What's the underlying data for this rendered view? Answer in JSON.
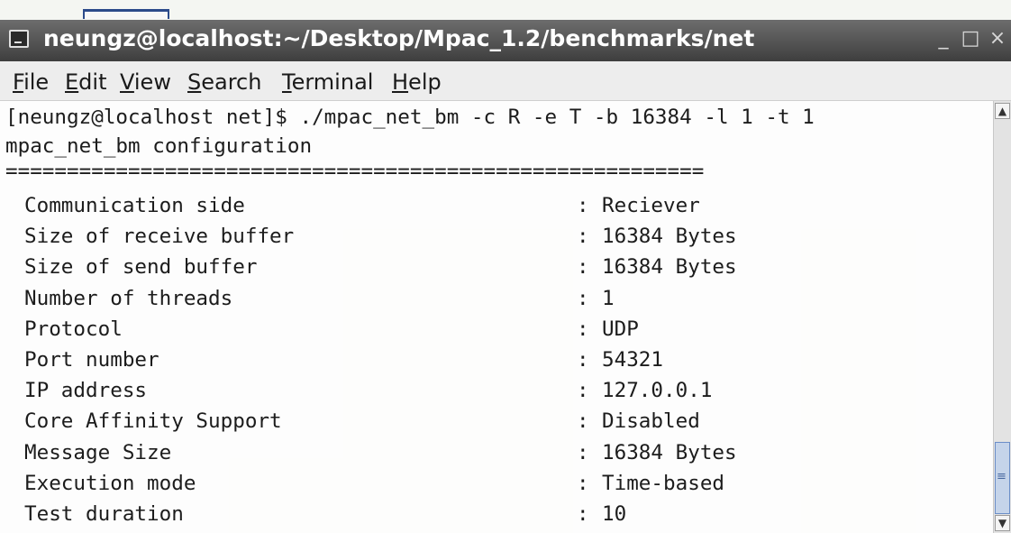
{
  "window": {
    "title": "neungz@localhost:~/Desktop/Mpac_1.2/benchmarks/net",
    "icon": "terminal-icon",
    "controls": {
      "minimize": "_",
      "maximize": "□",
      "close": "×"
    }
  },
  "menubar": {
    "items": [
      {
        "accel": "F",
        "rest": "ile"
      },
      {
        "accel": "E",
        "rest": "dit"
      },
      {
        "accel": "V",
        "rest": "iew"
      },
      {
        "accel": "S",
        "rest": "earch"
      },
      {
        "accel": "T",
        "rest": "erminal"
      },
      {
        "accel": "H",
        "rest": "elp"
      }
    ]
  },
  "terminal": {
    "command_line": "[neungz@localhost net]$ ./mpac_net_bm -c R -e T -b 16384 -l 1 -t 1",
    "heading": "mpac_net_bm configuration",
    "rule": "=========================================================",
    "rows": [
      {
        "label": "Communication side",
        "value": "Reciever"
      },
      {
        "label": "Size of receive buffer",
        "value": "16384 Bytes"
      },
      {
        "label": "Size of send buffer",
        "value": "16384 Bytes"
      },
      {
        "label": "Number of threads",
        "value": "1"
      },
      {
        "label": "Protocol",
        "value": "UDP"
      },
      {
        "label": "Port number",
        "value": "54321"
      },
      {
        "label": "IP address",
        "value": "127.0.0.1"
      },
      {
        "label": "Core Affinity Support",
        "value": "Disabled"
      },
      {
        "label": "Message Size",
        "value": "16384 Bytes"
      },
      {
        "label": "Execution mode",
        "value": "Time-based"
      },
      {
        "label": "Test duration",
        "value": "10"
      }
    ],
    "separator": ":"
  },
  "colors": {
    "titlebar": "#4a4a4a",
    "menubar": "#ededed",
    "scroll_thumb": "#c5d4ea"
  }
}
